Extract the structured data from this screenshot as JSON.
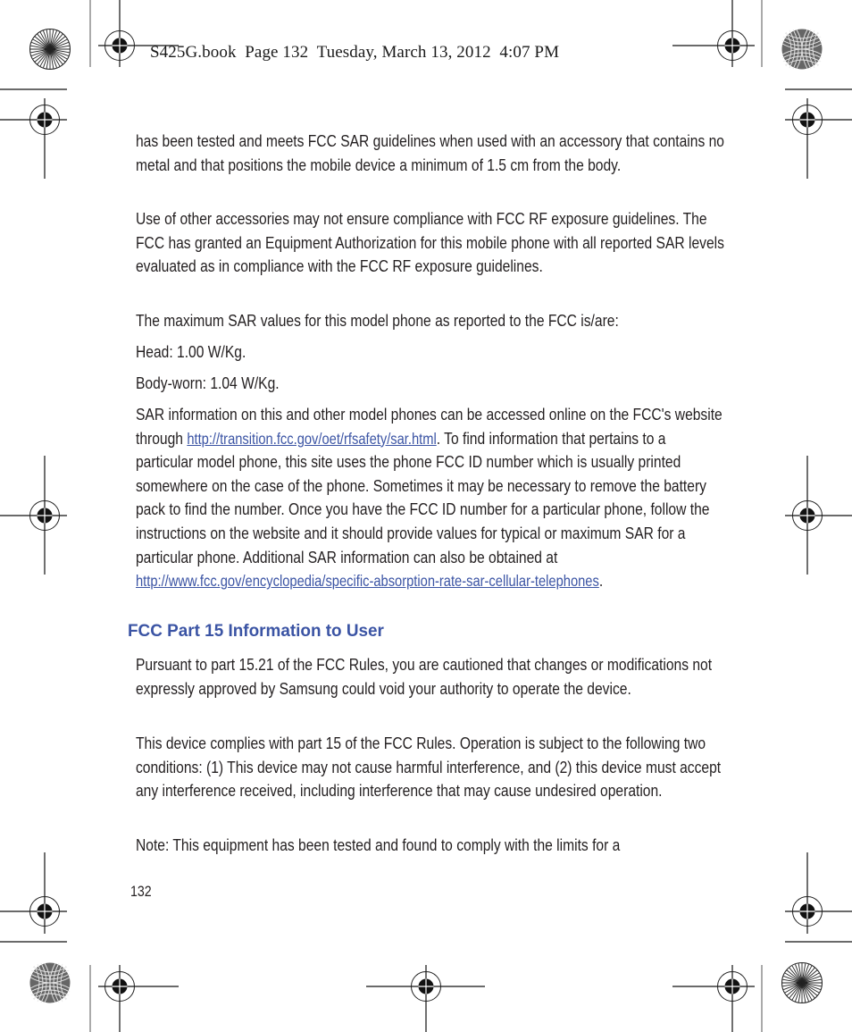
{
  "slug_line": "S425G.book  Page 132  Tuesday, March 13, 2012  4:07 PM",
  "paragraphs": {
    "p1": "has been tested and meets FCC SAR guidelines when used with an accessory that contains no metal and that positions the mobile device a minimum of 1.5 cm from the body.",
    "p2": "Use of other accessories may not ensure compliance with FCC RF exposure guidelines. The FCC has granted an Equipment Authorization for this mobile phone with all reported SAR levels evaluated as in compliance with the FCC RF exposure guidelines.",
    "p3": "The maximum SAR values for this model phone as reported to the FCC is/are:",
    "p4": "Head: 1.00 W/Kg.",
    "p5": "Body-worn: 1.04 W/Kg.",
    "p6": {
      "before_link1": "SAR information on this and other model phones can be accessed online on the FCC's website through ",
      "link1": "http://transition.fcc.gov/oet/rfsafety/sar.html",
      "after_link1": ".  To find information that pertains to a particular model phone, this site uses the phone FCC ID number which is usually printed somewhere on the case of the phone. Sometimes it may be necessary to remove the battery pack to find the number. Once you have the FCC ID number for a particular phone, follow the instructions on the website and it should provide values for typical or maximum SAR for a particular phone. Additional SAR information can also be obtained at  ",
      "link2": "http://www.fcc.gov/encyclopedia/specific-absorption-rate-sar-cellular-telephones",
      "after_link2": "."
    },
    "p7": "Pursuant to part 15.21 of the FCC Rules, you are cautioned that changes or modifications not expressly approved by Samsung could void your authority to operate the device.",
    "p8": "This device complies with part 15 of the FCC Rules. Operation is subject to the following two conditions: (1) This device may not cause harmful interference, and (2) this device must accept any interference received, including interference that may cause undesired operation.",
    "p9": "Note: This equipment has been tested and found to comply with the limits for a"
  },
  "section_heading": "FCC Part 15 Information to User",
  "page_number": "132",
  "colors": {
    "text": "#231f20",
    "accent_blue": "#3b54a4"
  },
  "icons": {
    "registration_mark": "crosshair-target-icon",
    "radial_star_target": "starburst-target-icon",
    "moire_target": "moire-target-icon"
  }
}
